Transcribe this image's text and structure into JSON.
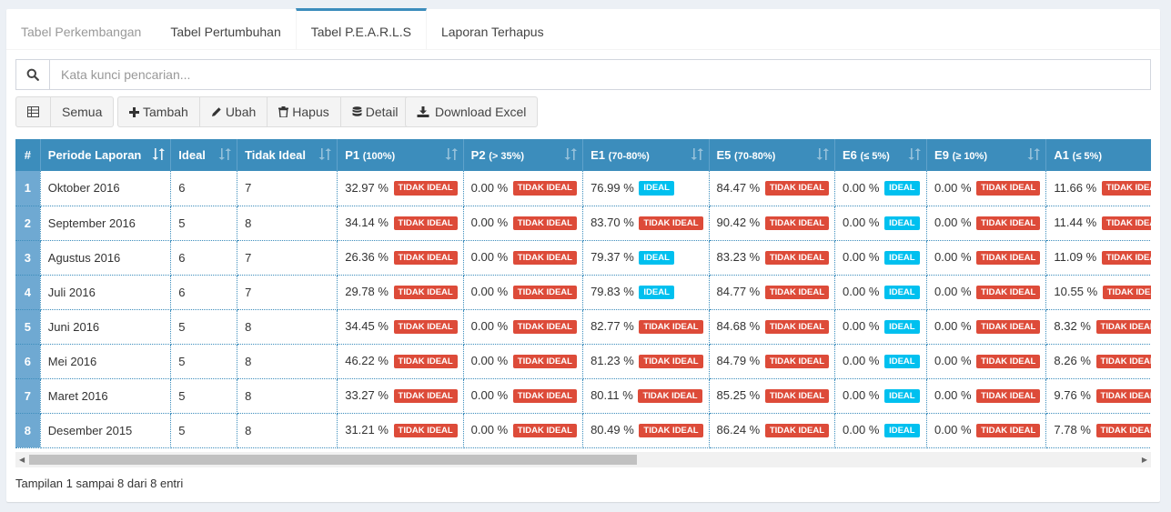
{
  "tabs": [
    {
      "label": "Tabel Perkembangan"
    },
    {
      "label": "Tabel Pertumbuhan"
    },
    {
      "label": "Tabel P.E.A.R.L.S"
    },
    {
      "label": "Laporan Terhapus"
    }
  ],
  "search": {
    "placeholder": "Kata kunci pencarian..."
  },
  "toolbar": {
    "semua": "Semua",
    "tambah": "Tambah",
    "ubah": "Ubah",
    "hapus": "Hapus",
    "detail": "Detail",
    "download": "Download Excel"
  },
  "columns": [
    {
      "label": "#"
    },
    {
      "label": "Periode Laporan"
    },
    {
      "label": "Ideal"
    },
    {
      "label": "Tidak Ideal"
    },
    {
      "main": "P1",
      "sub": "(100%)"
    },
    {
      "main": "P2",
      "sub": "(> 35%)"
    },
    {
      "main": "E1",
      "sub": "(70-80%)"
    },
    {
      "main": "E5",
      "sub": "(70-80%)"
    },
    {
      "main": "E6",
      "sub": "(≤ 5%)"
    },
    {
      "main": "E9",
      "sub": "(≥ 10%)"
    },
    {
      "main": "A1",
      "sub": "(≤ 5%)"
    }
  ],
  "labels": {
    "bad": "TIDAK IDEAL",
    "good": "IDEAL"
  },
  "rows": [
    {
      "no": "1",
      "periode": "Oktober 2016",
      "ideal": "6",
      "tidak": "7",
      "m": [
        [
          "32.97 %",
          "bad"
        ],
        [
          "0.00 %",
          "bad"
        ],
        [
          "76.99 %",
          "good"
        ],
        [
          "84.47 %",
          "bad"
        ],
        [
          "0.00 %",
          "good"
        ],
        [
          "0.00 %",
          "bad"
        ],
        [
          "11.66 %",
          "bad"
        ]
      ]
    },
    {
      "no": "2",
      "periode": "September 2016",
      "ideal": "5",
      "tidak": "8",
      "m": [
        [
          "34.14 %",
          "bad"
        ],
        [
          "0.00 %",
          "bad"
        ],
        [
          "83.70 %",
          "bad"
        ],
        [
          "90.42 %",
          "bad"
        ],
        [
          "0.00 %",
          "good"
        ],
        [
          "0.00 %",
          "bad"
        ],
        [
          "11.44 %",
          "bad"
        ]
      ]
    },
    {
      "no": "3",
      "periode": "Agustus 2016",
      "ideal": "6",
      "tidak": "7",
      "m": [
        [
          "26.36 %",
          "bad"
        ],
        [
          "0.00 %",
          "bad"
        ],
        [
          "79.37 %",
          "good"
        ],
        [
          "83.23 %",
          "bad"
        ],
        [
          "0.00 %",
          "good"
        ],
        [
          "0.00 %",
          "bad"
        ],
        [
          "11.09 %",
          "bad"
        ]
      ]
    },
    {
      "no": "4",
      "periode": "Juli 2016",
      "ideal": "6",
      "tidak": "7",
      "m": [
        [
          "29.78 %",
          "bad"
        ],
        [
          "0.00 %",
          "bad"
        ],
        [
          "79.83 %",
          "good"
        ],
        [
          "84.77 %",
          "bad"
        ],
        [
          "0.00 %",
          "good"
        ],
        [
          "0.00 %",
          "bad"
        ],
        [
          "10.55 %",
          "bad"
        ]
      ]
    },
    {
      "no": "5",
      "periode": "Juni 2016",
      "ideal": "5",
      "tidak": "8",
      "m": [
        [
          "34.45 %",
          "bad"
        ],
        [
          "0.00 %",
          "bad"
        ],
        [
          "82.77 %",
          "bad"
        ],
        [
          "84.68 %",
          "bad"
        ],
        [
          "0.00 %",
          "good"
        ],
        [
          "0.00 %",
          "bad"
        ],
        [
          "8.32 %",
          "bad"
        ]
      ]
    },
    {
      "no": "6",
      "periode": "Mei 2016",
      "ideal": "5",
      "tidak": "8",
      "m": [
        [
          "46.22 %",
          "bad"
        ],
        [
          "0.00 %",
          "bad"
        ],
        [
          "81.23 %",
          "bad"
        ],
        [
          "84.79 %",
          "bad"
        ],
        [
          "0.00 %",
          "good"
        ],
        [
          "0.00 %",
          "bad"
        ],
        [
          "8.26 %",
          "bad"
        ]
      ]
    },
    {
      "no": "7",
      "periode": "Maret 2016",
      "ideal": "5",
      "tidak": "8",
      "m": [
        [
          "33.27 %",
          "bad"
        ],
        [
          "0.00 %",
          "bad"
        ],
        [
          "80.11 %",
          "bad"
        ],
        [
          "85.25 %",
          "bad"
        ],
        [
          "0.00 %",
          "good"
        ],
        [
          "0.00 %",
          "bad"
        ],
        [
          "9.76 %",
          "bad"
        ]
      ]
    },
    {
      "no": "8",
      "periode": "Desember 2015",
      "ideal": "5",
      "tidak": "8",
      "m": [
        [
          "31.21 %",
          "bad"
        ],
        [
          "0.00 %",
          "bad"
        ],
        [
          "80.49 %",
          "bad"
        ],
        [
          "86.24 %",
          "bad"
        ],
        [
          "0.00 %",
          "good"
        ],
        [
          "0.00 %",
          "bad"
        ],
        [
          "7.78 %",
          "bad"
        ]
      ]
    }
  ],
  "footer": {
    "info": "Tampilan 1 sampai 8 dari 8 entri"
  },
  "colors": {
    "primary": "#3c8dbc",
    "danger": "#dd4b39",
    "info": "#00c0ef"
  }
}
